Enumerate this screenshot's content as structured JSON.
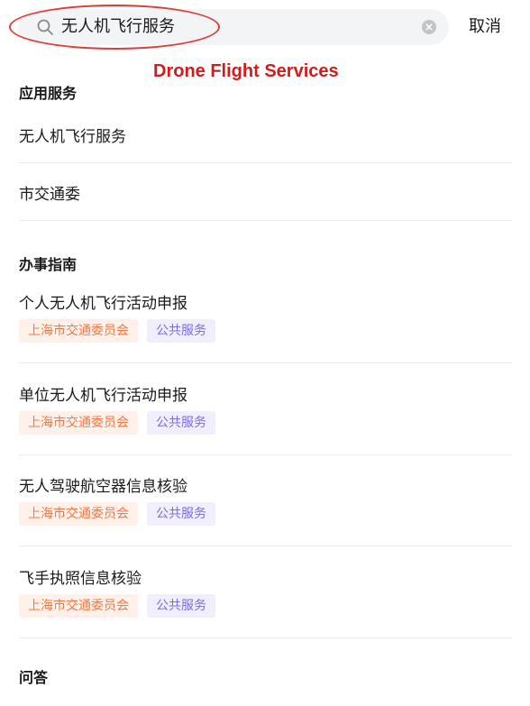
{
  "search": {
    "query": "无人机飞行服务",
    "cancel_label": "取消"
  },
  "annotation": {
    "text": "Drone Flight Services",
    "color": "#d01c1c"
  },
  "sections": {
    "app_services": {
      "title": "应用服务",
      "items": [
        "无人机飞行服务",
        "市交通委"
      ]
    },
    "guides": {
      "title": "办事指南",
      "items": [
        {
          "title": "个人无人机飞行活动申报",
          "tags": [
            "上海市交通委员会",
            "公共服务"
          ]
        },
        {
          "title": "单位无人机飞行活动申报",
          "tags": [
            "上海市交通委员会",
            "公共服务"
          ]
        },
        {
          "title": "无人驾驶航空器信息核验",
          "tags": [
            "上海市交通委员会",
            "公共服务"
          ]
        },
        {
          "title": "飞手执照信息核验",
          "tags": [
            "上海市交通委员会",
            "公共服务"
          ]
        }
      ]
    },
    "qa": {
      "title": "问答"
    }
  },
  "colors": {
    "org_tag_bg": "#fff1ea",
    "org_tag_text": "#f07a45",
    "category_tag_bg": "#f1effd",
    "category_tag_text": "#7c6de0"
  },
  "icons": {
    "search": "search-icon",
    "clear": "clear-icon"
  }
}
